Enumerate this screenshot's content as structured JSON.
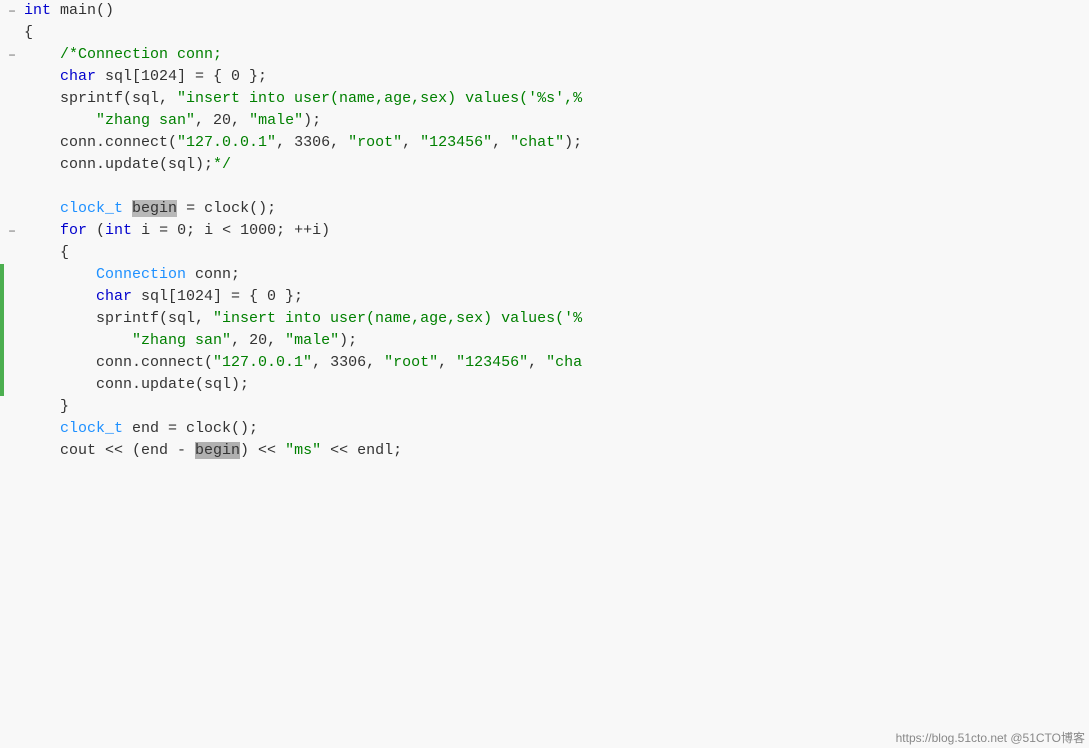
{
  "editor": {
    "background": "#f8f8f8",
    "font": "Courier New",
    "fontSize": 15,
    "lineHeight": 22,
    "watermark": "https://blog.51cto.net @51CTO博客"
  },
  "lines": [
    {
      "id": 1,
      "foldable": true,
      "foldIcon": "−",
      "leftBarColor": "none",
      "indentGuides": [],
      "tokens": [
        {
          "type": "kw",
          "text": "int"
        },
        {
          "type": "plain",
          "text": " main()"
        }
      ]
    },
    {
      "id": 2,
      "foldable": false,
      "foldIcon": "",
      "leftBarColor": "none",
      "indentGuides": [],
      "tokens": [
        {
          "type": "plain",
          "text": "{"
        }
      ]
    },
    {
      "id": 3,
      "foldable": true,
      "foldIcon": "−",
      "leftBarColor": "none",
      "indentGuides": [
        72
      ],
      "tokens": [
        {
          "type": "plain",
          "text": "    "
        },
        {
          "type": "comment",
          "text": "/*Connection conn;"
        }
      ]
    },
    {
      "id": 4,
      "foldable": false,
      "foldIcon": "",
      "leftBarColor": "none",
      "indentGuides": [
        72
      ],
      "tokens": [
        {
          "type": "plain",
          "text": "    "
        },
        {
          "type": "kw",
          "text": "char"
        },
        {
          "type": "plain",
          "text": " sql[1024] = { 0 };"
        }
      ]
    },
    {
      "id": 5,
      "foldable": false,
      "foldIcon": "",
      "leftBarColor": "none",
      "indentGuides": [
        72
      ],
      "tokens": [
        {
          "type": "plain",
          "text": "    sprintf(sql, "
        },
        {
          "type": "str",
          "text": "\"insert into user(name,age,sex) values('%s',%"
        },
        {
          "type": "plain",
          "text": ""
        }
      ]
    },
    {
      "id": 6,
      "foldable": false,
      "foldIcon": "",
      "leftBarColor": "none",
      "indentGuides": [
        72,
        144
      ],
      "tokens": [
        {
          "type": "plain",
          "text": "        "
        },
        {
          "type": "str",
          "text": "\"zhang san\""
        },
        {
          "type": "plain",
          "text": ", 20, "
        },
        {
          "type": "str",
          "text": "\"male\""
        },
        {
          "type": "plain",
          "text": ");"
        }
      ]
    },
    {
      "id": 7,
      "foldable": false,
      "foldIcon": "",
      "leftBarColor": "none",
      "indentGuides": [
        72
      ],
      "tokens": [
        {
          "type": "plain",
          "text": "    conn.connect("
        },
        {
          "type": "str",
          "text": "\"127.0.0.1\""
        },
        {
          "type": "plain",
          "text": ", 3306, "
        },
        {
          "type": "str",
          "text": "\"root\""
        },
        {
          "type": "plain",
          "text": ", "
        },
        {
          "type": "str",
          "text": "\"123456\""
        },
        {
          "type": "plain",
          "text": ", "
        },
        {
          "type": "str",
          "text": "\"chat\""
        },
        {
          "type": "plain",
          "text": ");"
        }
      ]
    },
    {
      "id": 8,
      "foldable": false,
      "foldIcon": "",
      "leftBarColor": "none",
      "indentGuides": [
        72
      ],
      "tokens": [
        {
          "type": "plain",
          "text": "    conn.update(sql);"
        },
        {
          "type": "comment",
          "text": "*/"
        }
      ]
    },
    {
      "id": 9,
      "foldable": false,
      "foldIcon": "",
      "leftBarColor": "none",
      "indentGuides": [],
      "tokens": [
        {
          "type": "plain",
          "text": ""
        }
      ]
    },
    {
      "id": 10,
      "foldable": false,
      "foldIcon": "",
      "leftBarColor": "none",
      "indentGuides": [
        72
      ],
      "tokens": [
        {
          "type": "plain",
          "text": "    "
        },
        {
          "type": "type",
          "text": "clock_t"
        },
        {
          "type": "plain",
          "text": " "
        },
        {
          "type": "highlight",
          "text": "begin"
        },
        {
          "type": "plain",
          "text": " = clock();"
        }
      ]
    },
    {
      "id": 11,
      "foldable": true,
      "foldIcon": "−",
      "leftBarColor": "none",
      "indentGuides": [
        72
      ],
      "tokens": [
        {
          "type": "plain",
          "text": "    "
        },
        {
          "type": "kw",
          "text": "for"
        },
        {
          "type": "plain",
          "text": " ("
        },
        {
          "type": "kw",
          "text": "int"
        },
        {
          "type": "plain",
          "text": " i = 0; i < 1000; ++i)"
        }
      ]
    },
    {
      "id": 12,
      "foldable": false,
      "foldIcon": "",
      "leftBarColor": "none",
      "indentGuides": [
        72
      ],
      "tokens": [
        {
          "type": "plain",
          "text": "    {"
        }
      ]
    },
    {
      "id": 13,
      "foldable": false,
      "foldIcon": "",
      "leftBarColor": "green",
      "indentGuides": [
        72,
        144
      ],
      "tokens": [
        {
          "type": "plain",
          "text": "        "
        },
        {
          "type": "type",
          "text": "Connection"
        },
        {
          "type": "plain",
          "text": " conn;"
        }
      ]
    },
    {
      "id": 14,
      "foldable": false,
      "foldIcon": "",
      "leftBarColor": "green",
      "indentGuides": [
        72,
        144
      ],
      "tokens": [
        {
          "type": "plain",
          "text": "        "
        },
        {
          "type": "kw",
          "text": "char"
        },
        {
          "type": "plain",
          "text": " sql[1024] = { 0 };"
        }
      ]
    },
    {
      "id": 15,
      "foldable": false,
      "foldIcon": "",
      "leftBarColor": "green",
      "indentGuides": [
        72,
        144
      ],
      "tokens": [
        {
          "type": "plain",
          "text": "        sprintf(sql, "
        },
        {
          "type": "str",
          "text": "\"insert into user(name,age,sex) values('%"
        },
        {
          "type": "plain",
          "text": ""
        }
      ]
    },
    {
      "id": 16,
      "foldable": false,
      "foldIcon": "",
      "leftBarColor": "green",
      "indentGuides": [
        72,
        144,
        216
      ],
      "tokens": [
        {
          "type": "plain",
          "text": "            "
        },
        {
          "type": "str",
          "text": "\"zhang san\""
        },
        {
          "type": "plain",
          "text": ", 20, "
        },
        {
          "type": "str",
          "text": "\"male\""
        },
        {
          "type": "plain",
          "text": ");"
        }
      ]
    },
    {
      "id": 17,
      "foldable": false,
      "foldIcon": "",
      "leftBarColor": "green",
      "indentGuides": [
        72,
        144
      ],
      "tokens": [
        {
          "type": "plain",
          "text": "        conn.connect("
        },
        {
          "type": "str",
          "text": "\"127.0.0.1\""
        },
        {
          "type": "plain",
          "text": ", 3306, "
        },
        {
          "type": "str",
          "text": "\"root\""
        },
        {
          "type": "plain",
          "text": ", "
        },
        {
          "type": "str",
          "text": "\"123456\""
        },
        {
          "type": "plain",
          "text": ", "
        },
        {
          "type": "str",
          "text": "\"cha"
        },
        {
          "type": "plain",
          "text": ""
        }
      ]
    },
    {
      "id": 18,
      "foldable": false,
      "foldIcon": "",
      "leftBarColor": "green",
      "indentGuides": [
        72,
        144
      ],
      "tokens": [
        {
          "type": "plain",
          "text": "        conn.update(sql);"
        }
      ]
    },
    {
      "id": 19,
      "foldable": false,
      "foldIcon": "",
      "leftBarColor": "none",
      "indentGuides": [
        72
      ],
      "tokens": [
        {
          "type": "plain",
          "text": "    }"
        }
      ]
    },
    {
      "id": 20,
      "foldable": false,
      "foldIcon": "",
      "leftBarColor": "none",
      "indentGuides": [
        72
      ],
      "tokens": [
        {
          "type": "plain",
          "text": "    "
        },
        {
          "type": "type",
          "text": "clock_t"
        },
        {
          "type": "plain",
          "text": " end = clock();"
        }
      ]
    },
    {
      "id": 21,
      "foldable": false,
      "foldIcon": "",
      "leftBarColor": "none",
      "indentGuides": [
        72
      ],
      "tokens": [
        {
          "type": "plain",
          "text": "    cout << (end - "
        },
        {
          "type": "highlight2",
          "text": "begin"
        },
        {
          "type": "plain",
          "text": ") << "
        },
        {
          "type": "str",
          "text": "\"ms\""
        },
        {
          "type": "plain",
          "text": " << endl;"
        }
      ]
    }
  ]
}
